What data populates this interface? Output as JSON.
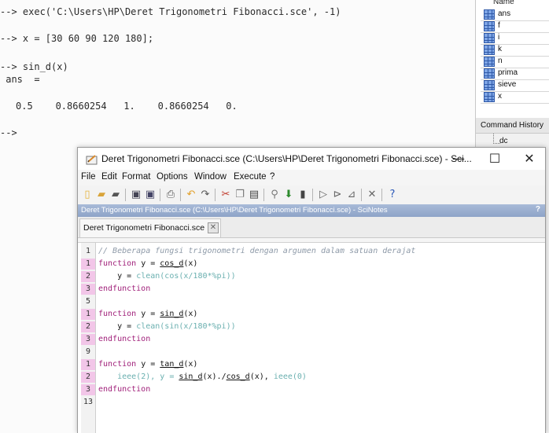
{
  "console": {
    "lines": [
      "--> exec('C:\\Users\\HP\\Deret Trigonometri Fibonacci.sce', -1)",
      "--> x = [30 60 90 120 180];",
      "--> sin_d(x)",
      " ans  =",
      "0.5    0.8660254   1.    0.8660254   0.",
      "-->"
    ]
  },
  "variable_browser": {
    "header": "Name",
    "variables": [
      "ans",
      "f",
      "i",
      "k",
      "n",
      "prima",
      "sieve",
      "x"
    ]
  },
  "command_history": {
    "title": "Command History",
    "entries": [
      "dc"
    ]
  },
  "editor": {
    "window_title": "Deret Trigonometri Fibonacci.sce (C:\\Users\\HP\\Deret Trigonometri Fibonacci.sce) - Sci...",
    "window_buttons": {
      "minimize": "—",
      "maximize": "☐",
      "close": "✕"
    },
    "menu": [
      "File",
      "Edit",
      "Format",
      "Options",
      "Window",
      "Execute",
      "?"
    ],
    "path_bar": "Deret Trigonometri Fibonacci.sce (C:\\Users\\HP\\Deret Trigonometri Fibonacci.sce) - SciNotes",
    "path_help": "?",
    "tab_label": "Deret Trigonometri Fibonacci.sce",
    "tab_close": "✕",
    "line_numbers": [
      "1",
      "1",
      "2",
      "3",
      "5",
      "1",
      "2",
      "3",
      "9",
      "1",
      "2",
      "3",
      "13"
    ],
    "code": {
      "l1_comment": "// Beberapa fungsi trigonometri dengan argumen dalam satuan derajat",
      "l2_kw": "function",
      "l2_rest": " y = ",
      "l2_fn": "cos_d",
      "l2_arg": "(x)",
      "l3_dots": "    ",
      "l3_text": "y = ",
      "l3_call": "clean(cos(x/180*%pi))",
      "end": "endfunction",
      "l6_fn": "sin_d",
      "l7_call": "clean(sin(x/180*%pi))",
      "l10_fn": "tan_d",
      "l11_a": "ieee(2), y = ",
      "l11_b": "sin_d",
      "l11_c": "(x)./",
      "l11_d": "cos_d",
      "l11_e": "(x), ",
      "l11_f": "ieee(0)"
    }
  }
}
